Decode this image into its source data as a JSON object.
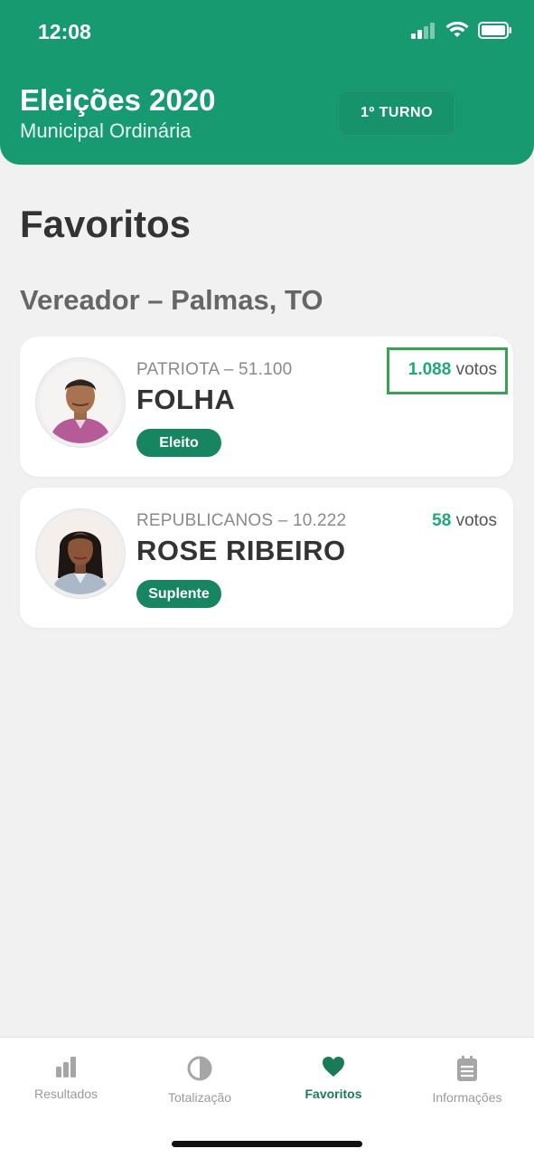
{
  "status_bar": {
    "time": "12:08"
  },
  "header": {
    "title": "Eleições 2020",
    "subtitle": "Municipal Ordinária",
    "turno_label": "1º TURNO",
    "color": "#179a6f"
  },
  "page": {
    "title": "Favoritos",
    "section_title": "Vereador – Palmas, TO"
  },
  "candidates": [
    {
      "party": "PATRIOTA – 51.100",
      "name": "FOLHA",
      "status": "Eleito",
      "votes": "1.088",
      "votes_label": "votos"
    },
    {
      "party": "REPUBLICANOS – 10.222",
      "name": "ROSE RIBEIRO",
      "status": "Suplente",
      "votes": "58",
      "votes_label": "votos"
    }
  ],
  "tabbar": {
    "items": [
      {
        "label": "Resultados",
        "icon": "bar-chart-icon"
      },
      {
        "label": "Totalização",
        "icon": "pie-chart-icon"
      },
      {
        "label": "Favoritos",
        "icon": "heart-icon",
        "active": true
      },
      {
        "label": "Informações",
        "icon": "clipboard-icon"
      }
    ],
    "active_color": "#1b7a58"
  }
}
